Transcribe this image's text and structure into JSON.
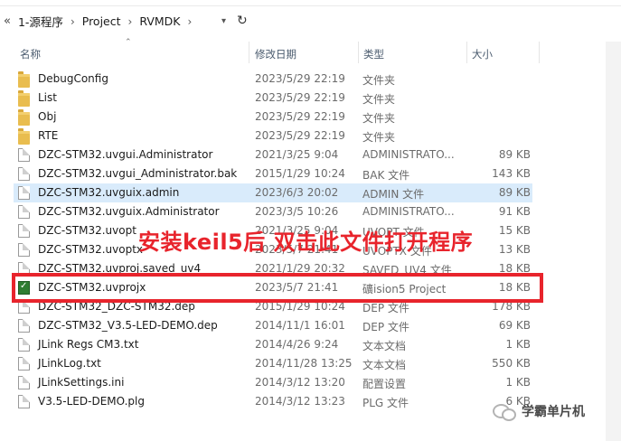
{
  "address": {
    "back_glyph": "«",
    "crumbs": [
      "1-源程序",
      "Project",
      "RVMDK"
    ],
    "separator": "›"
  },
  "columns": {
    "name": "名称",
    "date": "修改日期",
    "type": "类型",
    "size": "大小"
  },
  "rows": [
    {
      "name": "DebugConfig",
      "date": "2023/5/29 22:19",
      "type": "文件夹",
      "size": "",
      "icon": "folder-icon"
    },
    {
      "name": "List",
      "date": "2023/5/29 22:19",
      "type": "文件夹",
      "size": "",
      "icon": "folder-icon"
    },
    {
      "name": "Obj",
      "date": "2023/5/29 22:19",
      "type": "文件夹",
      "size": "",
      "icon": "folder-icon"
    },
    {
      "name": "RTE",
      "date": "2023/5/29 22:19",
      "type": "文件夹",
      "size": "",
      "icon": "folder-icon"
    },
    {
      "name": "DZC-STM32.uvgui.Administrator",
      "date": "2021/3/25 9:04",
      "type": "ADMINISTRATO...",
      "size": "89 KB",
      "icon": "file-icon"
    },
    {
      "name": "DZC-STM32.uvgui_Administrator.bak",
      "date": "2015/1/29 10:24",
      "type": "BAK 文件",
      "size": "143 KB",
      "icon": "file-icon"
    },
    {
      "name": "DZC-STM32.uvguix.admin",
      "date": "2023/6/3 20:02",
      "type": "ADMIN 文件",
      "size": "89 KB",
      "icon": "file-icon",
      "selected": true
    },
    {
      "name": "DZC-STM32.uvguix.Administrator",
      "date": "2023/3/5 10:26",
      "type": "ADMINISTRATO...",
      "size": "91 KB",
      "icon": "file-icon"
    },
    {
      "name": "DZC-STM32.uvopt",
      "date": "2021/3/25 9:04",
      "type": "UVOPT 文件",
      "size": "15 KB",
      "icon": "file-icon"
    },
    {
      "name": "DZC-STM32.uvoptx",
      "date": "2023/5/7 21:41",
      "type": "UVOPTX 文件",
      "size": "13 KB",
      "icon": "file-icon"
    },
    {
      "name": "DZC-STM32.uvproj.saved_uv4",
      "date": "2021/1/29 20:32",
      "type": "SAVED_UV4 文件",
      "size": "18 KB",
      "icon": "file-icon"
    },
    {
      "name": "DZC-STM32.uvprojx",
      "date": "2023/5/7 21:41",
      "type": "礦ision5 Project",
      "size": "18 KB",
      "icon": "keil-project-icon"
    },
    {
      "name": "DZC-STM32_DZC-STM32.dep",
      "date": "2015/1/29 10:24",
      "type": "DEP 文件",
      "size": "178 KB",
      "icon": "file-icon"
    },
    {
      "name": "DZC-STM32_V3.5-LED-DEMO.dep",
      "date": "2014/11/1 16:01",
      "type": "DEP 文件",
      "size": "69 KB",
      "icon": "file-icon"
    },
    {
      "name": "JLink Regs CM3.txt",
      "date": "2014/4/26 9:24",
      "type": "文本文档",
      "size": "1 KB",
      "icon": "file-icon"
    },
    {
      "name": "JLinkLog.txt",
      "date": "2014/11/28 13:25",
      "type": "文本文档",
      "size": "550 KB",
      "icon": "file-icon"
    },
    {
      "name": "JLinkSettings.ini",
      "date": "2014/3/12 13:20",
      "type": "配置设置",
      "size": "1 KB",
      "icon": "file-icon"
    },
    {
      "name": "V3.5-LED-DEMO.plg",
      "date": "2014/3/12 13:23",
      "type": "PLG 文件",
      "size": "6 KB",
      "icon": "file-icon"
    }
  ],
  "annotation": {
    "text": "安装keil5后 双击此文件打开程序",
    "color": "#e8242c"
  },
  "watermark": {
    "text": "学霸单片机"
  },
  "colors": {
    "selection": "#d9ebfb",
    "highlight": "#e8242c",
    "folder": "#e9bd4f"
  }
}
